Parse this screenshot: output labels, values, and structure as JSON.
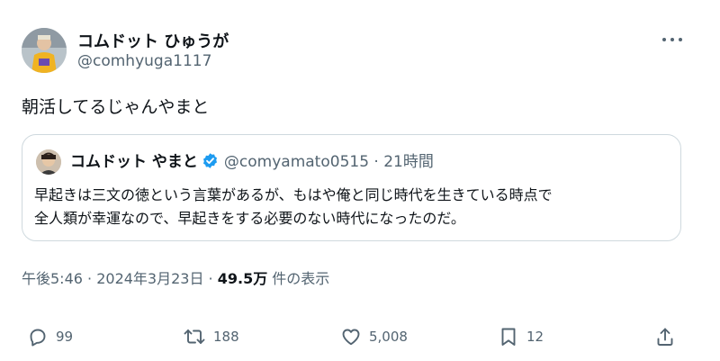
{
  "author": {
    "display_name": "コムドット ひゅうが",
    "handle": "@comhyuga1117"
  },
  "tweet": {
    "text": "朝活してるじゃんやまと"
  },
  "quoted": {
    "display_name": "コムドット やまと",
    "handle": "@comyamato0515",
    "separator": "·",
    "time": "21時間",
    "text_line1": "早起きは三文の徳という言葉があるが、もはや俺と同じ時代を生きている時点で",
    "text_line2": "全人類が幸運なので、早起きをする必要のない時代になったのだ。"
  },
  "meta": {
    "time": "午後5:46",
    "sep1": " · ",
    "date": "2024年3月23日",
    "sep2": " · ",
    "views": "49.5万",
    "views_label": " 件の表示"
  },
  "actions": {
    "reply_count": "99",
    "retweet_count": "188",
    "like_count": "5,008",
    "bookmark_count": "12"
  },
  "colors": {
    "verified": "#1d9bf0",
    "muted": "#536471",
    "text": "#0f1419",
    "border": "#cfd9de"
  }
}
